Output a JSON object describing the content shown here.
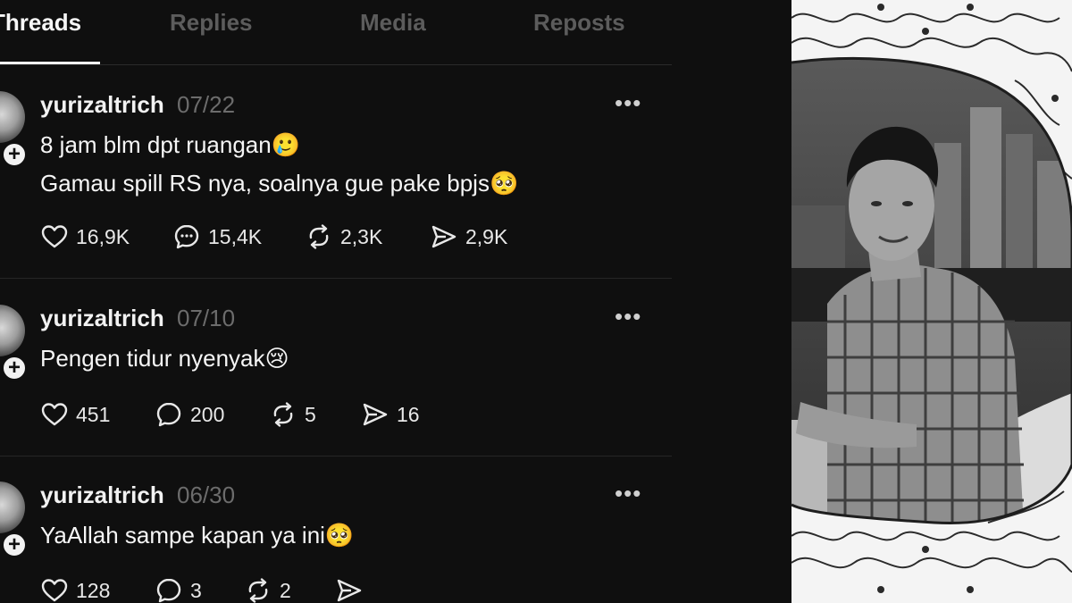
{
  "tabs": [
    "Threads",
    "Replies",
    "Media",
    "Reposts"
  ],
  "active_tab": "Threads",
  "posts": [
    {
      "username": "yurizaltrich",
      "date": "07/22",
      "lines": [
        "8 jam blm dpt ruangan🥲",
        "Gamau spill RS nya, soalnya gue pake bpjs🥺"
      ],
      "likes": "16,9K",
      "replies": "15,4K",
      "reposts": "2,3K",
      "shares": "2,9K"
    },
    {
      "username": "yurizaltrich",
      "date": "07/10",
      "lines": [
        "Pengen tidur nyenyak😢"
      ],
      "likes": "451",
      "replies": "200",
      "reposts": "5",
      "shares": "16"
    },
    {
      "username": "yurizaltrich",
      "date": "06/30",
      "lines": [
        "YaAllah sampe kapan ya ini🥺"
      ],
      "likes": "128",
      "replies": "3",
      "reposts": "2",
      "shares": ""
    }
  ],
  "more_label": "•••",
  "plus_label": "+"
}
